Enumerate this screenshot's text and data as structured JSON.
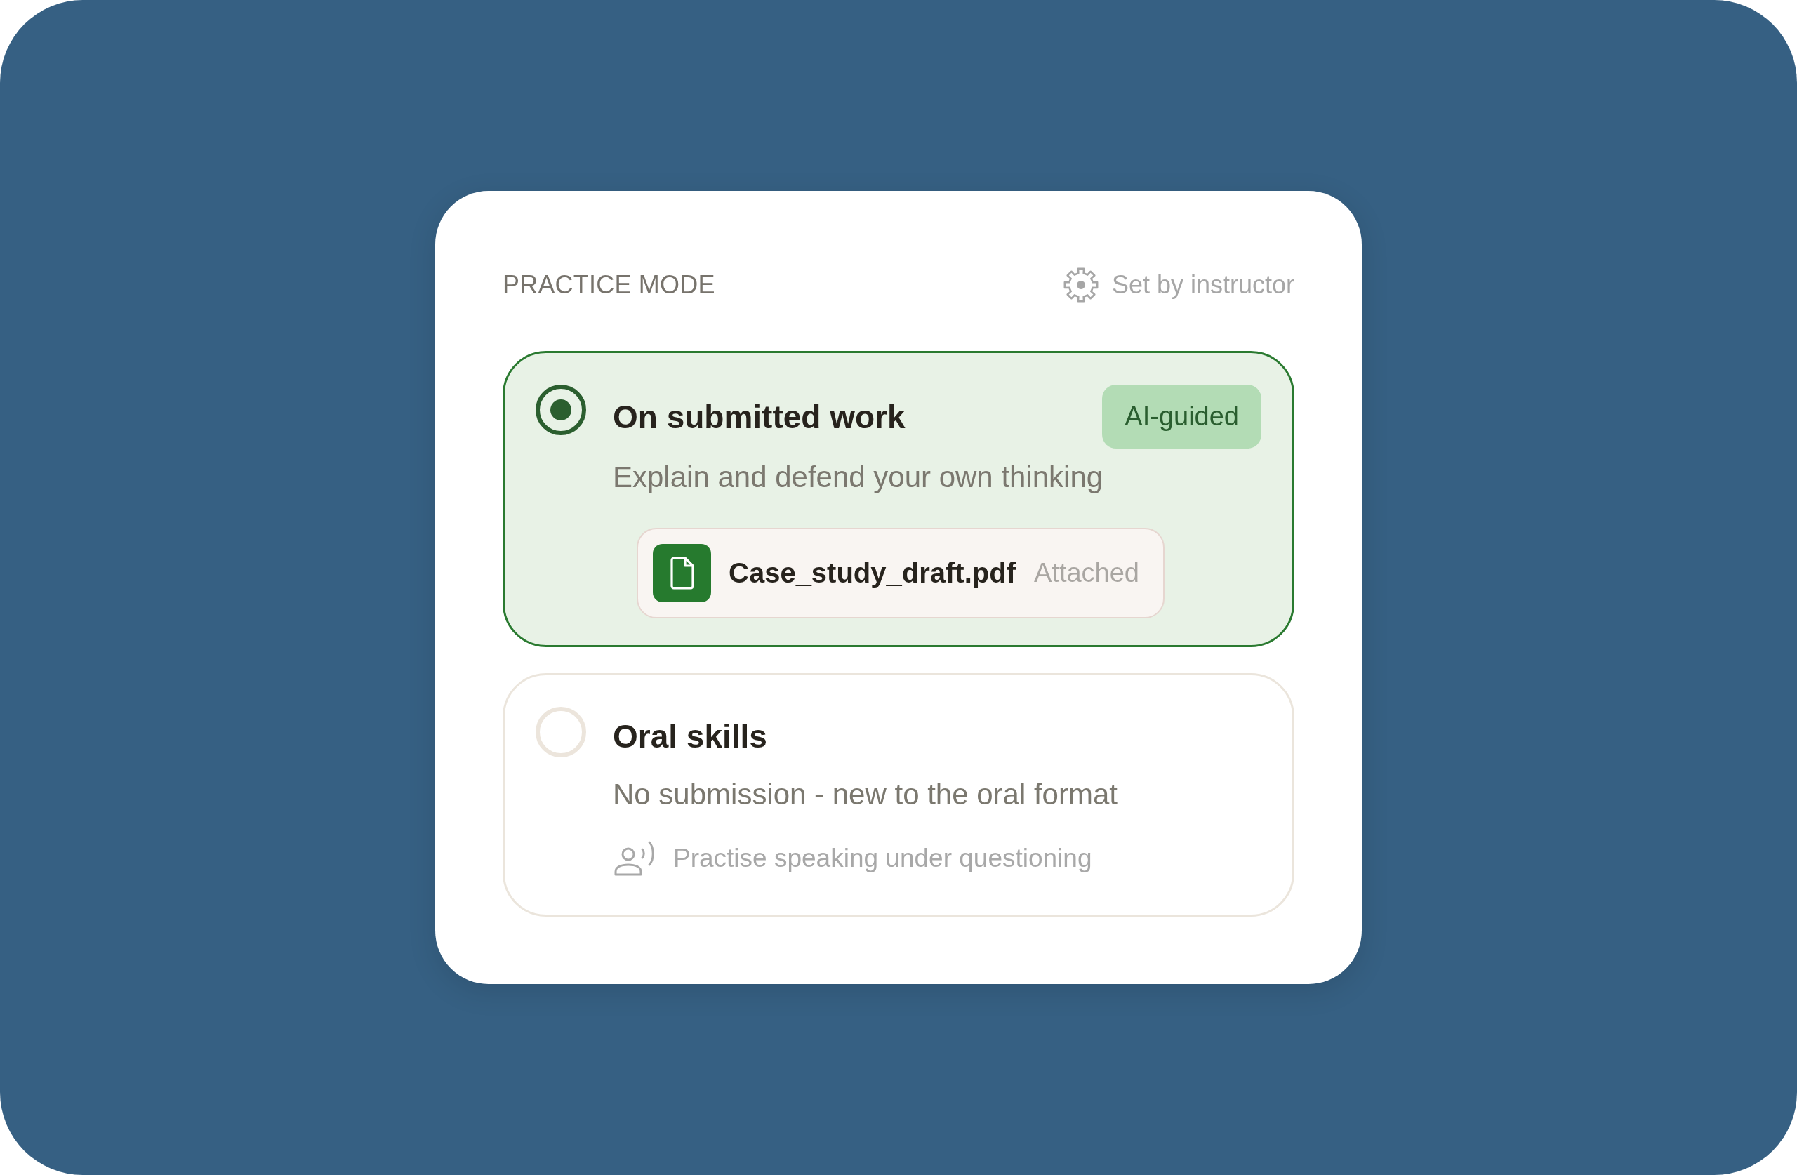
{
  "header": {
    "title": "PRACTICE MODE",
    "note": "Set by instructor"
  },
  "options": [
    {
      "title": "On submitted work",
      "selected": true,
      "badge": "AI-guided",
      "description": "Explain and defend your own thinking",
      "attachment": {
        "name": "Case_study_draft.pdf",
        "status": "Attached"
      }
    },
    {
      "title": "Oral skills",
      "selected": false,
      "description": "No submission - new to the oral format",
      "hint": "Practise speaking under questioning"
    }
  ]
}
